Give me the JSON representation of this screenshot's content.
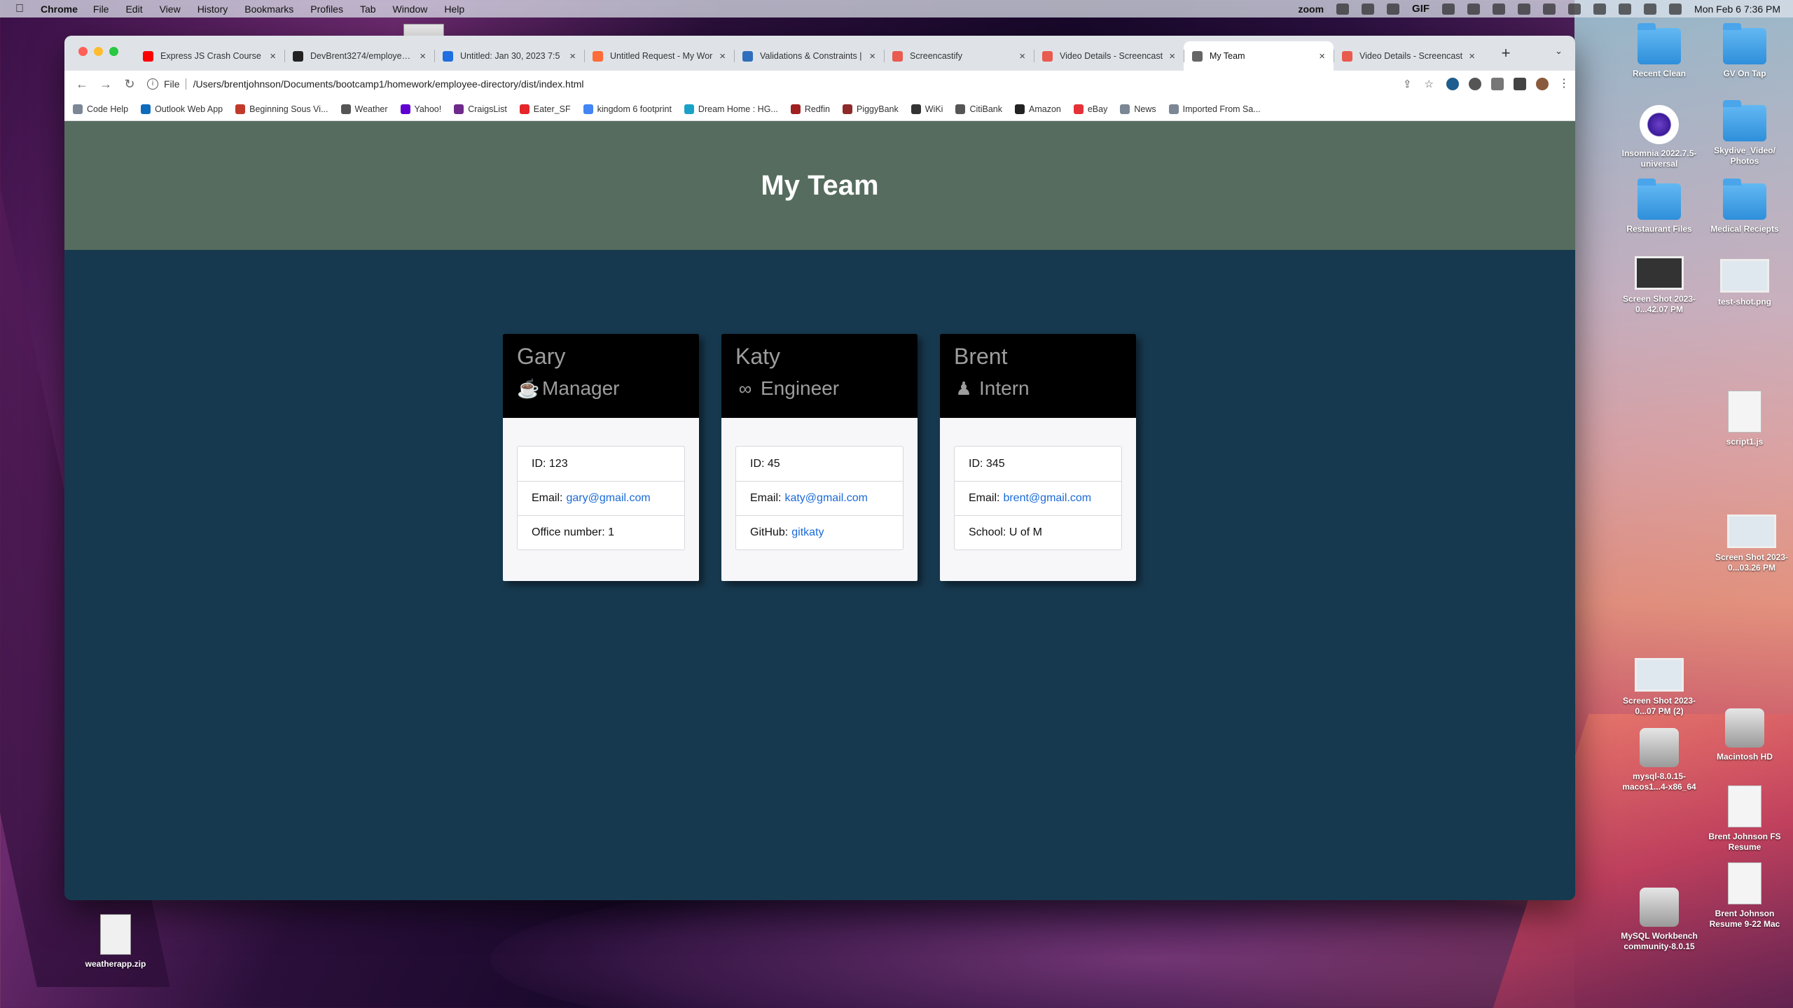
{
  "menubar": {
    "app": "Chrome",
    "menus": [
      "File",
      "Edit",
      "View",
      "History",
      "Bookmarks",
      "Profiles",
      "Tab",
      "Window",
      "Help"
    ],
    "zoom_label": "zoom",
    "gif_label": "GIF",
    "clock": "Mon Feb 6  7:36 PM"
  },
  "browser": {
    "tabs": [
      {
        "label": "Express JS Crash Course",
        "color": "#ff0000"
      },
      {
        "label": "DevBrent3274/employee-d",
        "color": "#222222"
      },
      {
        "label": "Untitled: Jan 30, 2023 7:5",
        "color": "#1f6fe0"
      },
      {
        "label": "Untitled Request - My Wor",
        "color": "#ff6c37"
      },
      {
        "label": "Validations & Constraints |",
        "color": "#2f6ebd"
      },
      {
        "label": "Screencastify",
        "color": "#e95a4f"
      },
      {
        "label": "Video Details - Screencast",
        "color": "#e95a4f"
      },
      {
        "label": "My Team",
        "color": "#666666"
      },
      {
        "label": "Video Details - Screencast",
        "color": "#e95a4f"
      }
    ],
    "active_tab_index": 7,
    "address": {
      "scheme": "File",
      "url": "/Users/brentjohnson/Documents/bootcamp1/homework/employee-directory/dist/index.html"
    },
    "bookmarks": [
      {
        "label": "Code Help",
        "color": "#7b8794"
      },
      {
        "label": "Outlook Web App",
        "color": "#0f6cbd"
      },
      {
        "label": "Beginning Sous Vi...",
        "color": "#c0392b"
      },
      {
        "label": "Weather",
        "color": "#555555"
      },
      {
        "label": "Yahoo!",
        "color": "#5f01d1"
      },
      {
        "label": "CraigsList",
        "color": "#6e2a8a"
      },
      {
        "label": "Eater_SF",
        "color": "#e5252a"
      },
      {
        "label": "kingdom 6 footprint",
        "color": "#4285f4"
      },
      {
        "label": "Dream Home : HG...",
        "color": "#1ba1c7"
      },
      {
        "label": "Redfin",
        "color": "#a02021"
      },
      {
        "label": "PiggyBank",
        "color": "#8e2a2a"
      },
      {
        "label": "WiKi",
        "color": "#333333"
      },
      {
        "label": "CitiBank",
        "color": "#555555"
      },
      {
        "label": "Amazon",
        "color": "#222222"
      },
      {
        "label": "eBay",
        "color": "#e53238"
      },
      {
        "label": "News",
        "color": "#7b8794"
      },
      {
        "label": "Imported From Sa...",
        "color": "#7b8794"
      }
    ]
  },
  "page": {
    "title": "My Team",
    "header_bg": "#566c5e",
    "body_bg": "#17394f",
    "employees": [
      {
        "name": "Gary",
        "role": "Manager",
        "role_icon": "coffee-mug-icon",
        "id_label": "ID:",
        "id": "123",
        "email_label": "Email:",
        "email": "gary@gmail.com",
        "extra_label": "Office number:",
        "extra": "1",
        "extra_is_link": false
      },
      {
        "name": "Katy",
        "role": "Engineer",
        "role_icon": "glasses-icon",
        "id_label": "ID:",
        "id": "45",
        "email_label": "Email:",
        "email": "katy@gmail.com",
        "extra_label": "GitHub:",
        "extra": "gitkaty",
        "extra_is_link": true
      },
      {
        "name": "Brent",
        "role": "Intern",
        "role_icon": "graduate-icon",
        "id_label": "ID:",
        "id": "345",
        "email_label": "Email:",
        "email": "brent@gmail.com",
        "extra_label": "School:",
        "extra": "U of M",
        "extra_is_link": false
      }
    ]
  },
  "desktop": {
    "icons": [
      {
        "label": "Recent Clean",
        "kind": "folder"
      },
      {
        "label": "GV On Tap",
        "kind": "folder"
      },
      {
        "label": "Insomnia 2022.7.5-universal",
        "kind": "app"
      },
      {
        "label": "Skydive_Video/ Photos",
        "kind": "folder"
      },
      {
        "label": "Restaurant Files",
        "kind": "folder"
      },
      {
        "label": "Medical Reciepts",
        "kind": "folder"
      },
      {
        "label": "Screen Shot 2023-0...42.07 PM",
        "kind": "shot"
      },
      {
        "label": "test-shot.png",
        "kind": "shot-light"
      },
      {
        "label": "script1.js",
        "kind": "doc"
      },
      {
        "label": "Screen Shot 2023-0...03.26 PM",
        "kind": "shot-light"
      },
      {
        "label": "Screen Shot 2023-0...07 PM (2)",
        "kind": "shot-light"
      },
      {
        "label": "Macintosh HD",
        "kind": "drive"
      },
      {
        "label": "mysql-8.0.15-macos1...4-x86_64",
        "kind": "drive"
      },
      {
        "label": "Brent Johnson FS Resume",
        "kind": "doc"
      },
      {
        "label": "MySQL Workbench community-8.0.15",
        "kind": "drive"
      },
      {
        "label": "Brent Johnson Resume 9-22 Mac",
        "kind": "doc"
      },
      {
        "label": "weatherapp.zip",
        "kind": "zip"
      }
    ]
  }
}
